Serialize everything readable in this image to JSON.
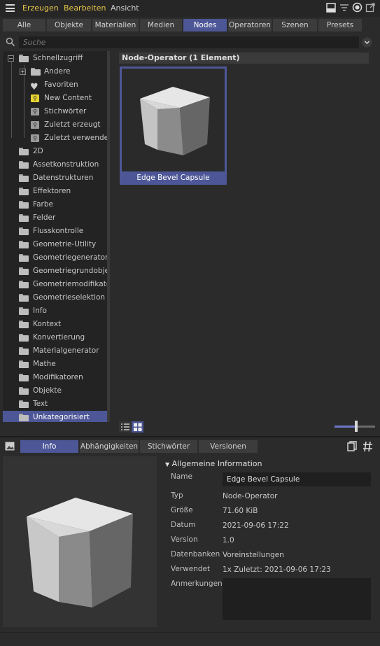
{
  "menubar": {
    "items": [
      "Erzeugen",
      "Bearbeiten",
      "Ansicht"
    ],
    "icons": [
      "window-icon",
      "filter-icon",
      "target-icon",
      "external-link-icon"
    ]
  },
  "tabs": [
    "Alle",
    "Objekte",
    "Materialien",
    "Medien",
    "Nodes",
    "Operatoren",
    "Szenen",
    "Presets"
  ],
  "active_tab": "Nodes",
  "search": {
    "placeholder": "Suche",
    "value": ""
  },
  "tree": {
    "root": "Schnellzugriff",
    "quick": [
      {
        "label": "Andere",
        "icon": "folder-icon"
      },
      {
        "label": "Favoriten",
        "icon": "heart-icon"
      },
      {
        "label": "New Content",
        "icon": "search-icon-yellow"
      },
      {
        "label": "Stichwörter",
        "icon": "search-icon"
      },
      {
        "label": "Zuletzt erzeugt",
        "icon": "search-icon"
      },
      {
        "label": "Zuletzt verwendet",
        "icon": "search-icon"
      }
    ],
    "folders": [
      "2D",
      "Assetkonstruktion",
      "Datenstrukturen",
      "Effektoren",
      "Farbe",
      "Felder",
      "Flusskontrolle",
      "Geometrie-Utility",
      "Geometriegenerator",
      "Geometriegrundobjel",
      "Geometriemodifikato",
      "Geometrieselektion",
      "Info",
      "Kontext",
      "Konvertierung",
      "Materialgenerator",
      "Mathe",
      "Modifikatoren",
      "Objekte",
      "Text",
      "Unkategorisiert"
    ],
    "selected": "Unkategorisiert"
  },
  "content": {
    "header": "Node-Operator (1 Element)",
    "items": [
      {
        "label": "Edge Bevel Capsule"
      }
    ]
  },
  "info_tabs": [
    "Info",
    "Abhängigkeiten",
    "Stichwörter",
    "Versionen"
  ],
  "info_active_tab": "Info",
  "info": {
    "section": "Allgemeine Information",
    "name_label": "Name",
    "name_value": "Edge Bevel Capsule",
    "rows": [
      {
        "label": "Typ",
        "value": "Node-Operator"
      },
      {
        "label": "Größe",
        "value": "71.60 KiB"
      },
      {
        "label": "Datum",
        "value": "2021-09-06 17:22"
      },
      {
        "label": "Version",
        "value": "1.0"
      },
      {
        "label": "Datenbanken",
        "value": "Voreinstellungen"
      },
      {
        "label": "Verwendet",
        "value": "1x Zuletzt: 2021-09-06 17:23"
      }
    ],
    "notes_label": "Anmerkungen",
    "notes_value": ""
  },
  "thumbnail_zoom": 0.55,
  "colors": {
    "accent": "#4d5797",
    "highlight": "#e6d230",
    "menu_text": "#e8c84a"
  }
}
